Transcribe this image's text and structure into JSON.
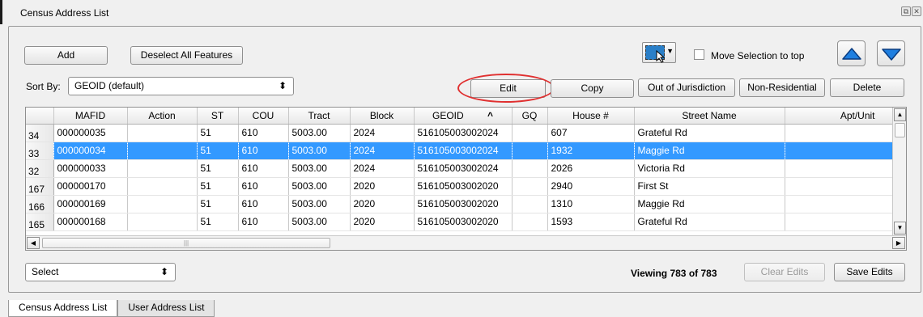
{
  "window": {
    "title": "Census Address List",
    "restore_glyph": "⧉",
    "close_glyph": "✕"
  },
  "toolbar": {
    "add_label": "Add",
    "deselect_label": "Deselect All Features",
    "move_selection_label": "Move Selection to top",
    "sort_by_label": "Sort By:",
    "sort_value": "GEOID (default)",
    "edit_label": "Edit",
    "copy_label": "Copy",
    "out_of_jurisdiction_label": "Out of Jurisdiction",
    "non_residential_label": "Non-Residential",
    "delete_label": "Delete",
    "selection_icon": "select-features-icon",
    "move_up_icon": "up-triangle-icon",
    "move_down_icon": "down-triangle-icon"
  },
  "table": {
    "columns": [
      "MAFID",
      "Action",
      "ST",
      "COU",
      "Tract",
      "Block",
      "GEOID",
      "GQ",
      "House #",
      "Street Name",
      "Apt/Unit"
    ],
    "sorted_indicator": "^",
    "rows": [
      {
        "rownum": "34",
        "cells": [
          "000000035",
          "",
          "51",
          "610",
          "5003.00",
          "2024",
          "516105003002024",
          "",
          "607",
          "Grateful Rd",
          ""
        ],
        "selected": false
      },
      {
        "rownum": "33",
        "cells": [
          "000000034",
          "",
          "51",
          "610",
          "5003.00",
          "2024",
          "516105003002024",
          "",
          "1932",
          "Maggie Rd",
          ""
        ],
        "selected": true
      },
      {
        "rownum": "32",
        "cells": [
          "000000033",
          "",
          "51",
          "610",
          "5003.00",
          "2024",
          "516105003002024",
          "",
          "2026",
          "Victoria Rd",
          ""
        ],
        "selected": false
      },
      {
        "rownum": "167",
        "cells": [
          "000000170",
          "",
          "51",
          "610",
          "5003.00",
          "2020",
          "516105003002020",
          "",
          "2940",
          "First St",
          ""
        ],
        "selected": false
      },
      {
        "rownum": "166",
        "cells": [
          "000000169",
          "",
          "51",
          "610",
          "5003.00",
          "2020",
          "516105003002020",
          "",
          "1310",
          "Maggie Rd",
          ""
        ],
        "selected": false
      },
      {
        "rownum": "165",
        "cells": [
          "000000168",
          "",
          "51",
          "610",
          "5003.00",
          "2020",
          "516105003002020",
          "",
          "1593",
          "Grateful Rd",
          ""
        ],
        "selected": false
      }
    ]
  },
  "footer": {
    "select_value": "Select",
    "viewing_text": "Viewing 783 of 783",
    "clear_edits_label": "Clear Edits",
    "save_edits_label": "Save Edits"
  },
  "tabs": [
    {
      "label": "Census Address List",
      "active": true
    },
    {
      "label": "User Address List",
      "active": false
    }
  ],
  "colors": {
    "selection": "#3399ff",
    "highlight_circle": "#e03030",
    "arrow_fill": "#1f7fe0"
  }
}
